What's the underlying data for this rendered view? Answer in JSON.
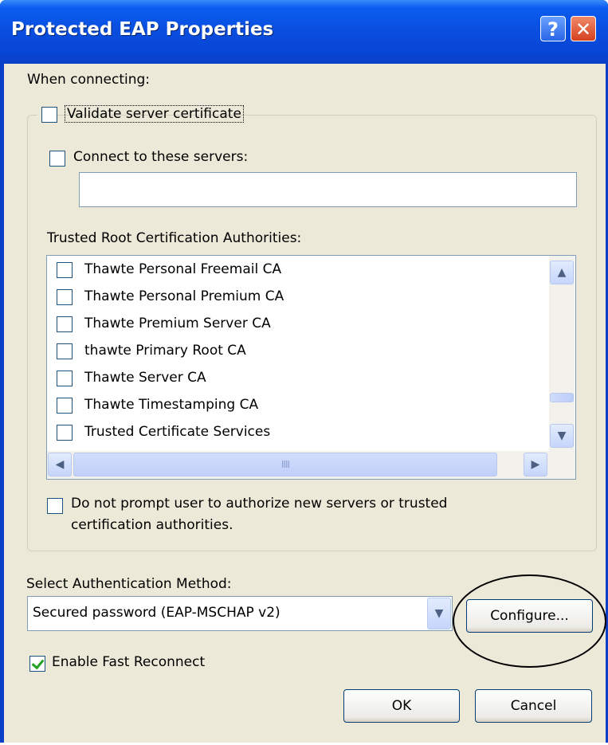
{
  "window": {
    "title": "Protected EAP Properties",
    "help_glyph": "?",
    "close_glyph": "✕"
  },
  "when_connecting_label": "When connecting:",
  "validate_server_certificate": {
    "label": "Validate server certificate",
    "checked": false
  },
  "connect_to_servers": {
    "label": "Connect to these servers:",
    "checked": false,
    "value": ""
  },
  "trusted_root_label": "Trusted Root Certification Authorities:",
  "ca_list": [
    {
      "label": "Thawte Personal Freemail CA",
      "checked": false
    },
    {
      "label": "Thawte Personal Premium CA",
      "checked": false
    },
    {
      "label": "Thawte Premium Server CA",
      "checked": false
    },
    {
      "label": "thawte Primary Root CA",
      "checked": false
    },
    {
      "label": "Thawte Server CA",
      "checked": false
    },
    {
      "label": "Thawte Timestamping CA",
      "checked": false
    },
    {
      "label": "Trusted Certificate Services",
      "checked": false
    }
  ],
  "scroll_glyphs": {
    "up": "▲",
    "down": "▼",
    "left": "◀",
    "right": "▶",
    "grip": "IIII"
  },
  "do_not_prompt": {
    "line1": "Do not prompt user to authorize new servers or trusted",
    "line2": "certification authorities.",
    "checked": false
  },
  "auth_method_label": "Select Authentication Method:",
  "auth_method": {
    "selected": "Secured password (EAP-MSCHAP v2)",
    "arrow": "▼"
  },
  "configure_button": "Configure...",
  "enable_fast_reconnect": {
    "label": "Enable Fast Reconnect",
    "checked": true
  },
  "ok_button": "OK",
  "cancel_button": "Cancel",
  "colors": {
    "titlebar": "#0a4fe0",
    "dialog_bg": "#ece9d8",
    "checkmark": "#21a121"
  }
}
